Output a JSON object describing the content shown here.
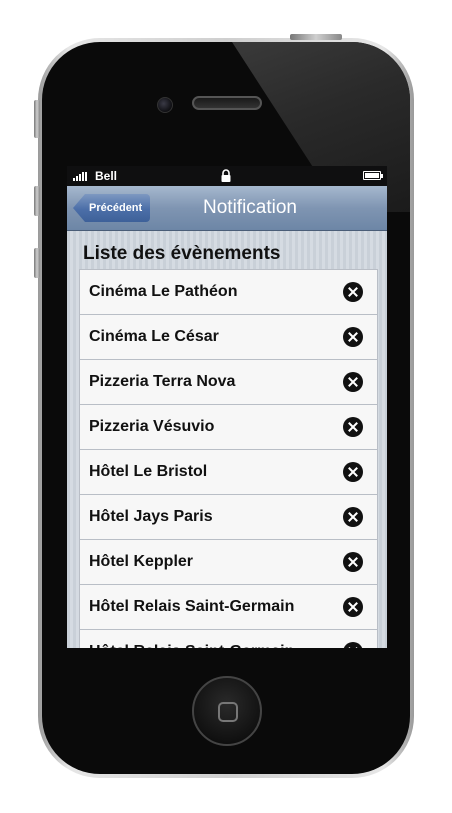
{
  "status_bar": {
    "carrier": "Bell"
  },
  "navbar": {
    "back_label": "Précédent",
    "title": "Notification"
  },
  "section_title": "Liste des évènements",
  "events": [
    {
      "label": "Cinéma Le Pathéon"
    },
    {
      "label": "Cinéma Le César"
    },
    {
      "label": "Pizzeria Terra Nova"
    },
    {
      "label": "Pizzeria Vésuvio"
    },
    {
      "label": "Hôtel Le Bristol"
    },
    {
      "label": "Hôtel Jays Paris"
    },
    {
      "label": "Hôtel Keppler"
    },
    {
      "label": "Hôtel Relais Saint-Germain"
    },
    {
      "label": "Hôtel Relais Saint-Germain"
    }
  ],
  "icons": {
    "delete": "close-circle-icon"
  }
}
